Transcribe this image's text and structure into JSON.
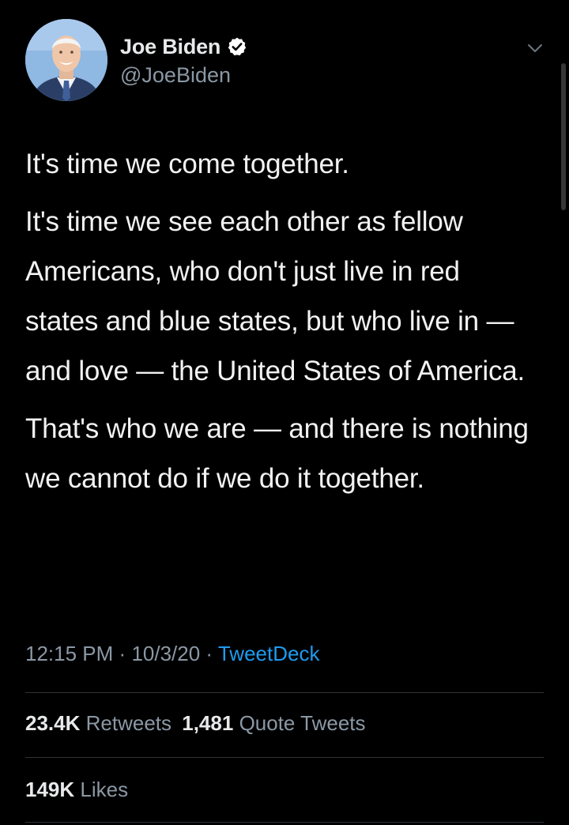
{
  "author": {
    "display_name": "Joe Biden",
    "handle": "@JoeBiden",
    "verified_icon": "verified-badge-icon",
    "avatar_icon": "profile-photo"
  },
  "tweet": {
    "paragraphs": [
      "It's time we come together.",
      "It's time we see each other as fellow Americans, who don't just live in red states and blue states, but who live in — and love — the United States of America.",
      "That's who we are — and there is nothing we cannot do if we do it together."
    ],
    "time": "12:15 PM",
    "date": "10/3/20",
    "separator": "·",
    "source": "TweetDeck"
  },
  "stats": {
    "retweets_count": "23.4K",
    "retweets_label": "Retweets",
    "quotes_count": "1,481",
    "quotes_label": "Quote Tweets",
    "likes_count": "149K",
    "likes_label": "Likes"
  },
  "colors": {
    "background": "#000000",
    "text": "#e7e9ea",
    "secondary_text": "#8b98a5",
    "link": "#1d9bf0",
    "divider": "#2f3336"
  }
}
